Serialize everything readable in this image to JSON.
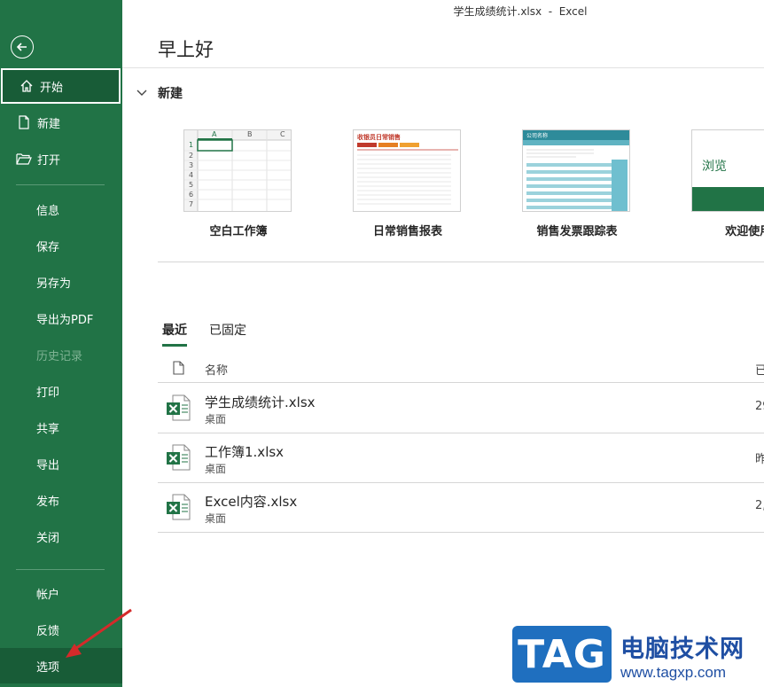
{
  "window": {
    "title": "学生成绩统计.xlsx  -  Excel"
  },
  "sidebar": {
    "back_icon": "back-arrow-icon",
    "items": [
      {
        "label": "开始",
        "icon": "home-icon"
      },
      {
        "label": "新建",
        "icon": "new-document-icon"
      },
      {
        "label": "打开",
        "icon": "open-folder-icon"
      },
      {
        "label": "信息"
      },
      {
        "label": "保存"
      },
      {
        "label": "另存为"
      },
      {
        "label": "导出为PDF"
      },
      {
        "label": "历史记录"
      },
      {
        "label": "打印"
      },
      {
        "label": "共享"
      },
      {
        "label": "导出"
      },
      {
        "label": "发布"
      },
      {
        "label": "关闭"
      },
      {
        "label": "帐户"
      },
      {
        "label": "反馈"
      },
      {
        "label": "选项"
      }
    ]
  },
  "main": {
    "greeting": "早上好",
    "new_section": {
      "title": "新建"
    },
    "templates": [
      {
        "label": "空白工作簿",
        "thumb_cols": [
          "A",
          "B",
          "C"
        ],
        "thumb_rows": [
          "1",
          "2",
          "3",
          "4",
          "5",
          "6",
          "7"
        ]
      },
      {
        "label": "日常销售报表",
        "thumb_title": "收银员日常销售"
      },
      {
        "label": "销售发票跟踪表",
        "thumb_title": "公司名称"
      },
      {
        "label": "欢迎使用 Ex",
        "thumb_title": "浏览"
      }
    ],
    "tabs": [
      {
        "label": "最近"
      },
      {
        "label": "已固定"
      }
    ],
    "list_header": {
      "name": "名称",
      "date": "已"
    },
    "files": [
      {
        "name": "学生成绩统计.xlsx",
        "location": "桌面",
        "date": "29"
      },
      {
        "name": "工作簿1.xlsx",
        "location": "桌面",
        "date": "昨"
      },
      {
        "name": "Excel内容.xlsx",
        "location": "桌面",
        "date": "2,"
      }
    ]
  },
  "watermark": {
    "logo": "TAG",
    "site_name": "电脑技术网",
    "url": "www.tagxp.com"
  },
  "colors": {
    "sidebar": "#217346",
    "sidebar_active": "#185c37",
    "accent": "#217346",
    "arrow": "#d42a2a"
  }
}
